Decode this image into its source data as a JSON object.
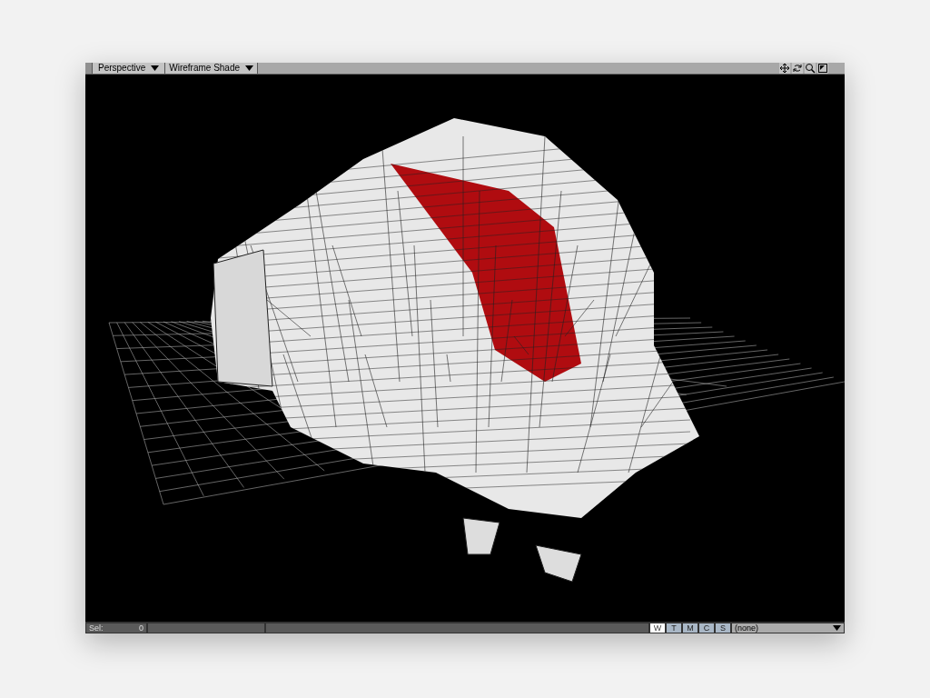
{
  "viewport": {
    "view_menu": "Perspective",
    "render_menu": "Wireframe Shade"
  },
  "status_bar": {
    "sel_label": "Sel:",
    "sel_count": "0",
    "modes": [
      {
        "label": "W",
        "selected": true
      },
      {
        "label": "T",
        "selected": false
      },
      {
        "label": "M",
        "selected": false
      },
      {
        "label": "C",
        "selected": false
      },
      {
        "label": "S",
        "selected": false
      }
    ],
    "surface_menu": "(none)"
  }
}
